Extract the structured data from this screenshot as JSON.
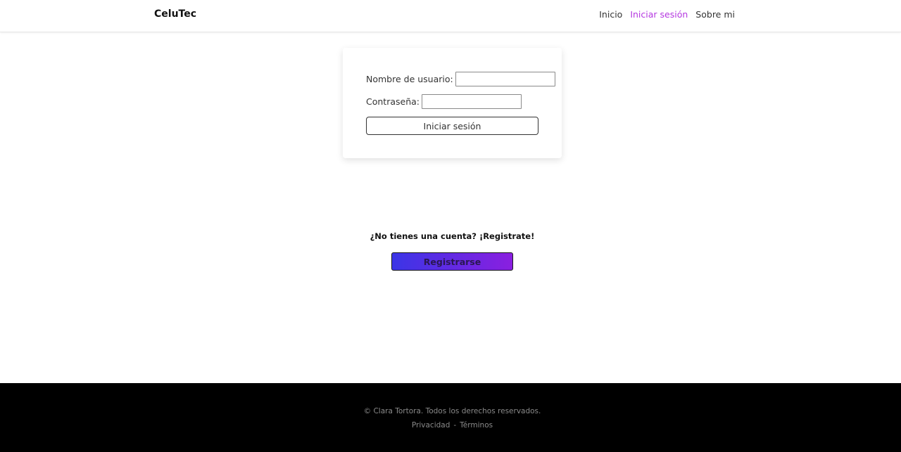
{
  "header": {
    "brand": "CeluTec",
    "nav": [
      {
        "label": "Inicio"
      },
      {
        "label": "Iniciar sesión",
        "active": true
      },
      {
        "label": "Sobre mi"
      }
    ]
  },
  "login": {
    "username_label": "Nombre de usuario:",
    "username_value": "",
    "password_label": "Contraseña:",
    "password_value": "",
    "submit_label": "Iniciar sesión"
  },
  "register": {
    "prompt": "¿No tienes una cuenta? ¡Registrate!",
    "button_label": "Registrarse"
  },
  "footer": {
    "copyright": "© Clara Tortora. Todos los derechos reservados.",
    "links": [
      {
        "label": "Privacidad"
      },
      {
        "label": "Términos"
      }
    ],
    "separator": "-"
  },
  "colors": {
    "accent_nav": "#b437e0",
    "gradient_start": "#3b35e6",
    "gradient_end": "#8a1fe0",
    "footer_bg": "#000000"
  }
}
